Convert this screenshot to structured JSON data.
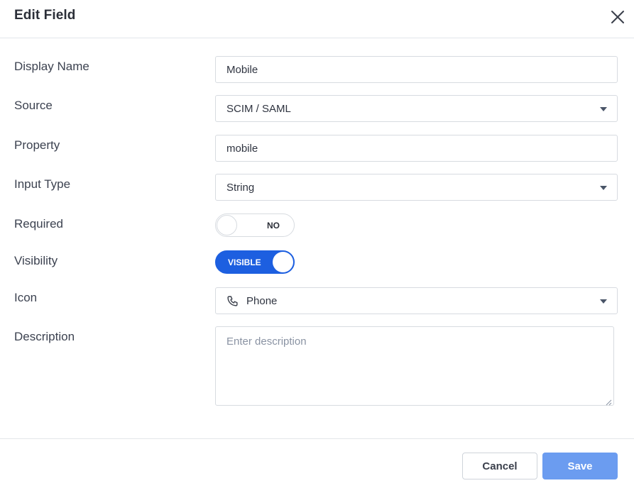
{
  "header": {
    "title": "Edit Field"
  },
  "form": {
    "display_name": {
      "label": "Display Name",
      "value": "Mobile"
    },
    "source": {
      "label": "Source",
      "value": "SCIM / SAML"
    },
    "property": {
      "label": "Property",
      "value": "mobile"
    },
    "input_type": {
      "label": "Input Type",
      "value": "String"
    },
    "required": {
      "label": "Required",
      "state": "NO"
    },
    "visibility": {
      "label": "Visibility",
      "state": "VISIBLE"
    },
    "icon": {
      "label": "Icon",
      "value": "Phone",
      "icon_name": "phone-icon"
    },
    "description": {
      "label": "Description",
      "placeholder": "Enter description",
      "value": ""
    }
  },
  "footer": {
    "cancel_label": "Cancel",
    "save_label": "Save"
  },
  "colors": {
    "primary": "#1d5fe0",
    "save_button": "#6b9cf0",
    "border": "#d7dbe0"
  }
}
